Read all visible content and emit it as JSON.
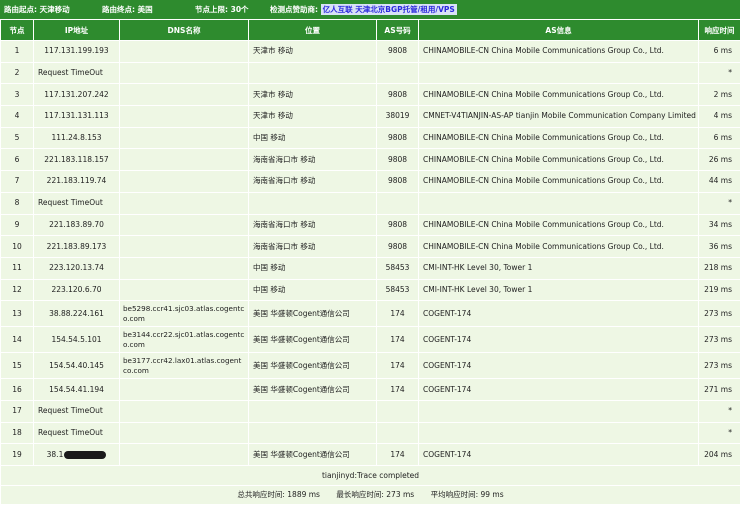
{
  "topbar": {
    "origin": "路由起点: 天津移动",
    "destination": "路由终点: 美国",
    "hop_limit": "节点上限: 30个",
    "sponsor_prefix": "检测点赞助商:",
    "sponsor_name": "亿人互联",
    "sponsor_tagline": "天津北京BGP托管/租用/VPS"
  },
  "columns": [
    "节点",
    "IP地址",
    "DNS名称",
    "位置",
    "AS号码",
    "AS信息",
    "响应时间"
  ],
  "rows": [
    {
      "hop": "1",
      "ip": "117.131.199.193",
      "dns": "",
      "loc": "天津市 移动",
      "asn": "9808",
      "asinfo": "CHINAMOBILE-CN China Mobile Communications Group Co., Ltd.",
      "time": "6 ms"
    },
    {
      "hop": "2",
      "ip": "Request TimeOut",
      "dns": "",
      "loc": "",
      "asn": "",
      "asinfo": "",
      "time": "*"
    },
    {
      "hop": "3",
      "ip": "117.131.207.242",
      "dns": "",
      "loc": "天津市 移动",
      "asn": "9808",
      "asinfo": "CHINAMOBILE-CN China Mobile Communications Group Co., Ltd.",
      "time": "2 ms"
    },
    {
      "hop": "4",
      "ip": "117.131.131.113",
      "dns": "",
      "loc": "天津市 移动",
      "asn": "38019",
      "asinfo": "CMNET-V4TIANJIN-AS-AP tianjin Mobile Communication Company Limited",
      "time": "4 ms"
    },
    {
      "hop": "5",
      "ip": "111.24.8.153",
      "dns": "",
      "loc": "中国 移动",
      "asn": "9808",
      "asinfo": "CHINAMOBILE-CN China Mobile Communications Group Co., Ltd.",
      "time": "6 ms"
    },
    {
      "hop": "6",
      "ip": "221.183.118.157",
      "dns": "",
      "loc": "海南省海口市 移动",
      "asn": "9808",
      "asinfo": "CHINAMOBILE-CN China Mobile Communications Group Co., Ltd.",
      "time": "26 ms"
    },
    {
      "hop": "7",
      "ip": "221.183.119.74",
      "dns": "",
      "loc": "海南省海口市 移动",
      "asn": "9808",
      "asinfo": "CHINAMOBILE-CN China Mobile Communications Group Co., Ltd.",
      "time": "44 ms"
    },
    {
      "hop": "8",
      "ip": "Request TimeOut",
      "dns": "",
      "loc": "",
      "asn": "",
      "asinfo": "",
      "time": "*"
    },
    {
      "hop": "9",
      "ip": "221.183.89.70",
      "dns": "",
      "loc": "海南省海口市 移动",
      "asn": "9808",
      "asinfo": "CHINAMOBILE-CN China Mobile Communications Group Co., Ltd.",
      "time": "34 ms"
    },
    {
      "hop": "10",
      "ip": "221.183.89.173",
      "dns": "",
      "loc": "海南省海口市 移动",
      "asn": "9808",
      "asinfo": "CHINAMOBILE-CN China Mobile Communications Group Co., Ltd.",
      "time": "36 ms"
    },
    {
      "hop": "11",
      "ip": "223.120.13.74",
      "dns": "",
      "loc": "中国 移动",
      "asn": "58453",
      "asinfo": "CMI-INT-HK Level 30, Tower 1",
      "time": "218 ms"
    },
    {
      "hop": "12",
      "ip": "223.120.6.70",
      "dns": "",
      "loc": "中国 移动",
      "asn": "58453",
      "asinfo": "CMI-INT-HK Level 30, Tower 1",
      "time": "219 ms"
    },
    {
      "hop": "13",
      "ip": "38.88.224.161",
      "dns": "be5298.ccr41.sjc03.atlas.cogentco.com",
      "loc": "美国 华盛顿Cogent通信公司",
      "asn": "174",
      "asinfo": "COGENT-174",
      "time": "273 ms"
    },
    {
      "hop": "14",
      "ip": "154.54.5.101",
      "dns": "be3144.ccr22.sjc01.atlas.cogentco.com",
      "loc": "美国 华盛顿Cogent通信公司",
      "asn": "174",
      "asinfo": "COGENT-174",
      "time": "273 ms"
    },
    {
      "hop": "15",
      "ip": "154.54.40.145",
      "dns": "be3177.ccr42.lax01.atlas.cogentco.com",
      "loc": "美国 华盛顿Cogent通信公司",
      "asn": "174",
      "asinfo": "COGENT-174",
      "time": "273 ms"
    },
    {
      "hop": "16",
      "ip": "154.54.41.194",
      "dns": "",
      "loc": "美国 华盛顿Cogent通信公司",
      "asn": "174",
      "asinfo": "COGENT-174",
      "time": "271 ms"
    },
    {
      "hop": "17",
      "ip": "Request TimeOut",
      "dns": "",
      "loc": "",
      "asn": "",
      "asinfo": "",
      "time": "*"
    },
    {
      "hop": "18",
      "ip": "Request TimeOut",
      "dns": "",
      "loc": "",
      "asn": "",
      "asinfo": "",
      "time": "*"
    },
    {
      "hop": "19",
      "ip": "38.1",
      "dns": "",
      "loc": "美国 华盛顿Cogent通信公司",
      "asn": "174",
      "asinfo": "COGENT-174",
      "time": "204 ms",
      "redacted": true
    }
  ],
  "summary": "tianjinyd:Trace completed",
  "footer": {
    "total": "总共响应时间: 1889 ms",
    "max": "最长响应时间: 273 ms",
    "avg": "平均响应时间: 99 ms"
  },
  "colors": {
    "header_green": "#2e8b2e",
    "row_bg": "#eef7e4",
    "sponsor_blue": "#2a2adc"
  }
}
